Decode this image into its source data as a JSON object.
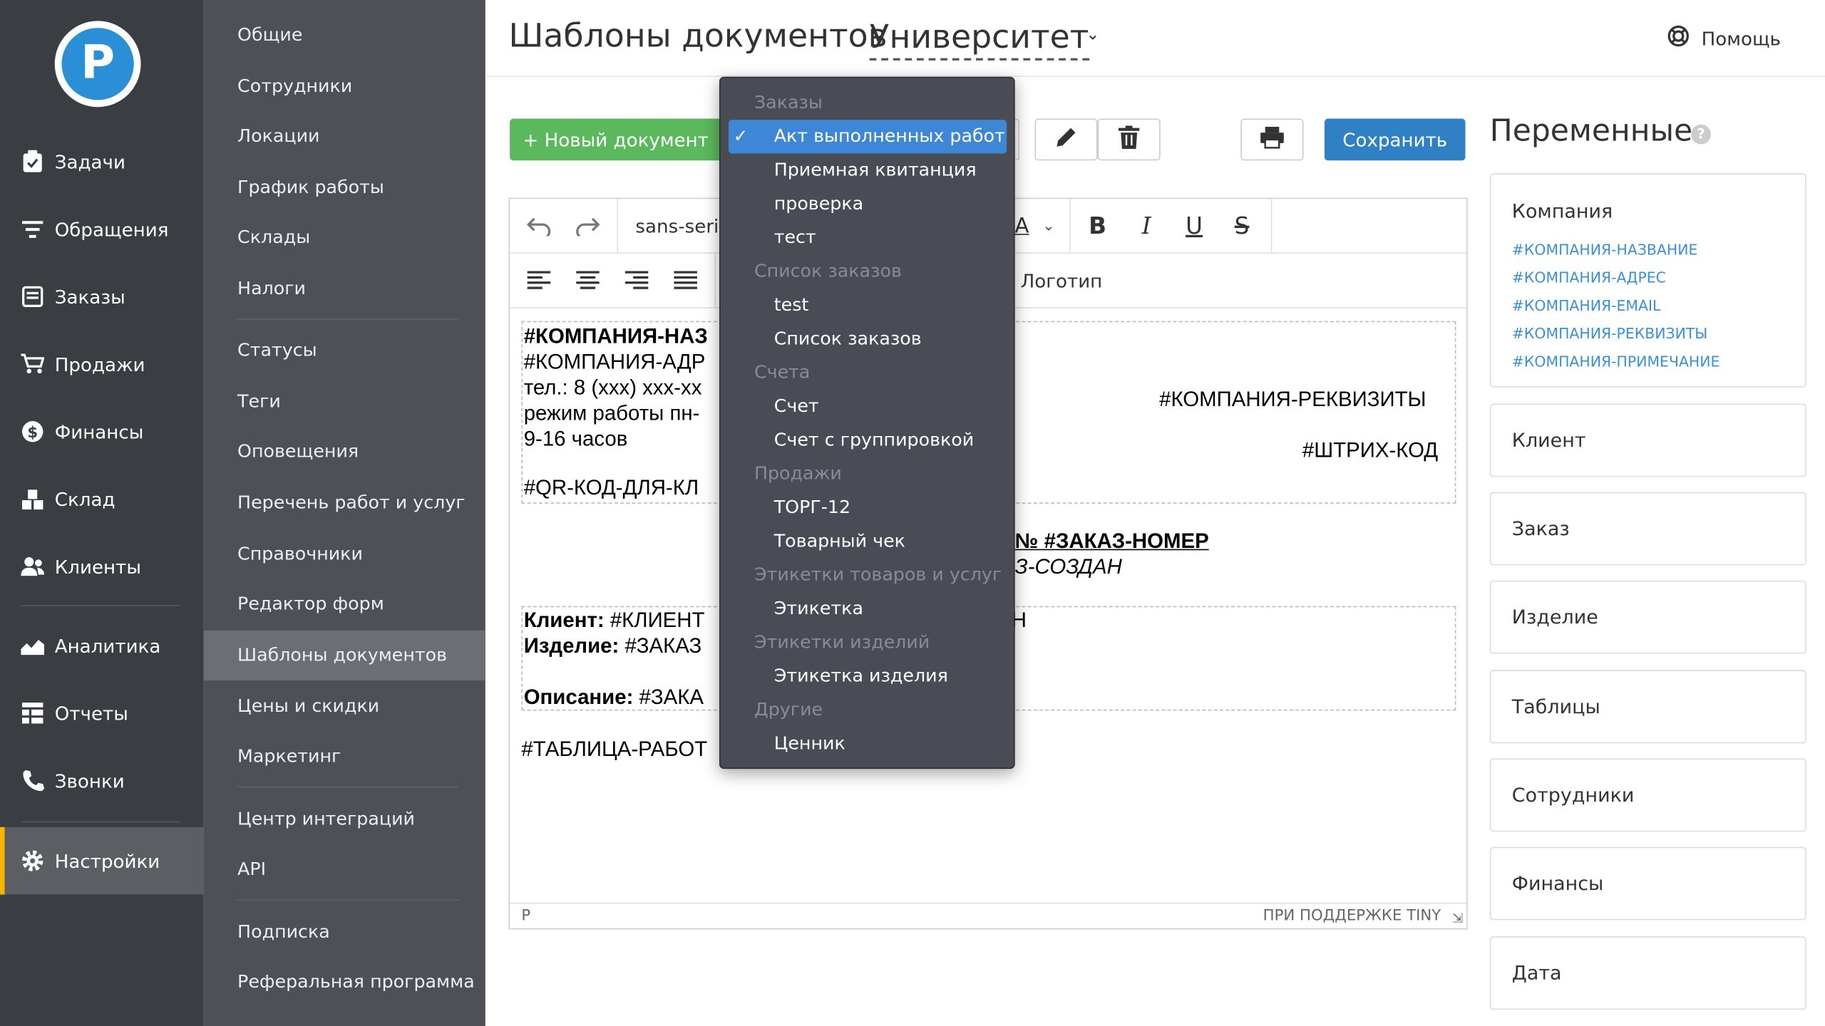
{
  "brand": {
    "logo_letter": "P",
    "accent": "#2a8fd6"
  },
  "main_nav": [
    {
      "label": "Задачи",
      "icon": "clipboard-icon"
    },
    {
      "label": "Обращения",
      "icon": "filter-icon"
    },
    {
      "label": "Заказы",
      "icon": "orders-icon"
    },
    {
      "label": "Продажи",
      "icon": "cart-icon"
    },
    {
      "label": "Финансы",
      "icon": "dollar-icon"
    },
    {
      "label": "Склад",
      "icon": "boxes-icon"
    },
    {
      "label": "Клиенты",
      "icon": "users-icon"
    },
    {
      "label": "Аналитика",
      "icon": "chart-icon"
    },
    {
      "label": "Отчеты",
      "icon": "table-icon"
    },
    {
      "label": "Звонки",
      "icon": "phone-icon"
    },
    {
      "label": "Настройки",
      "icon": "gear-icon",
      "active": true
    }
  ],
  "sub_nav": [
    "Общие",
    "Сотрудники",
    "Локации",
    "График работы",
    "Склады",
    "Налоги",
    "Статусы",
    "Теги",
    "Оповещения",
    "Перечень работ и услуг",
    "Справочники",
    "Редактор форм",
    "Шаблоны документов",
    "Цены и скидки",
    "Маркетинг",
    "Центр интеграций",
    "API",
    "Подписка",
    "Реферальная программа"
  ],
  "header": {
    "title": "Шаблоны документов",
    "location": "Университет",
    "help": "Помощь"
  },
  "toolbar": {
    "new_doc": "+ Новый документ",
    "save": "Сохранить"
  },
  "editor": {
    "font": "sans-seri",
    "logo_label": "Логотип",
    "statusbar_left": "P",
    "statusbar_right": "ПРИ ПОДДЕРЖКЕ TINY",
    "lines": {
      "company_name": "#КОМПАНИЯ-НАЗ",
      "company_addr": "#КОМПАНИЯ-АДР",
      "phone": "тел.: 8 (xxx) xxx-xx",
      "hours1": "режим работы  пн-",
      "hours2": "9-16 часов",
      "qr": "#QR-КОД-ДЛЯ-КЛ",
      "requisites": "#КОМПАНИЯ-РЕКВИЗИТЫ",
      "barcode": "#ШТРИХ-КОД",
      "order_num": "№ #ЗАКАЗ-НОМЕР",
      "order_created": "З-СОЗДАН",
      "client_label": "Клиент:",
      "client_val": " #КЛИЕНТ",
      "product_label": "Изделие:",
      "product_val": " #ЗАКАЗ",
      "desc_label": "Описание:",
      "desc_val": " #ЗАКА",
      "trailing_h": "Н",
      "works_table": "#ТАБЛИЦА-РАБОТ"
    }
  },
  "dropdown": [
    {
      "type": "group",
      "label": "Заказы"
    },
    {
      "type": "item",
      "label": "Акт выполненных работ",
      "selected": true
    },
    {
      "type": "item",
      "label": "Приемная квитанция"
    },
    {
      "type": "item",
      "label": "проверка"
    },
    {
      "type": "item",
      "label": "тест"
    },
    {
      "type": "group",
      "label": "Список заказов"
    },
    {
      "type": "item",
      "label": "test"
    },
    {
      "type": "item",
      "label": "Список заказов"
    },
    {
      "type": "group",
      "label": "Счета"
    },
    {
      "type": "item",
      "label": "Счет"
    },
    {
      "type": "item",
      "label": "Счет с группировкой"
    },
    {
      "type": "group",
      "label": "Продажи"
    },
    {
      "type": "item",
      "label": "ТОРГ-12"
    },
    {
      "type": "item",
      "label": "Товарный чек"
    },
    {
      "type": "group",
      "label": "Этикетки товаров и услуг"
    },
    {
      "type": "item",
      "label": "Этикетка"
    },
    {
      "type": "group",
      "label": "Этикетки изделий"
    },
    {
      "type": "item",
      "label": "Этикетка изделия"
    },
    {
      "type": "group",
      "label": "Другие"
    },
    {
      "type": "item",
      "label": "Ценник"
    }
  ],
  "variables": {
    "title": "Переменные",
    "help_mark": "?",
    "company": {
      "title": "Компания",
      "links": [
        "#КОМПАНИЯ-НАЗВАНИЕ",
        "#КОМПАНИЯ-АДРЕС",
        "#КОМПАНИЯ-EMAIL",
        "#КОМПАНИЯ-РЕКВИЗИТЫ",
        "#КОМПАНИЯ-ПРИМЕЧАНИЕ"
      ]
    },
    "sections": [
      "Клиент",
      "Заказ",
      "Изделие",
      "Таблицы",
      "Сотрудники",
      "Финансы",
      "Дата"
    ]
  }
}
